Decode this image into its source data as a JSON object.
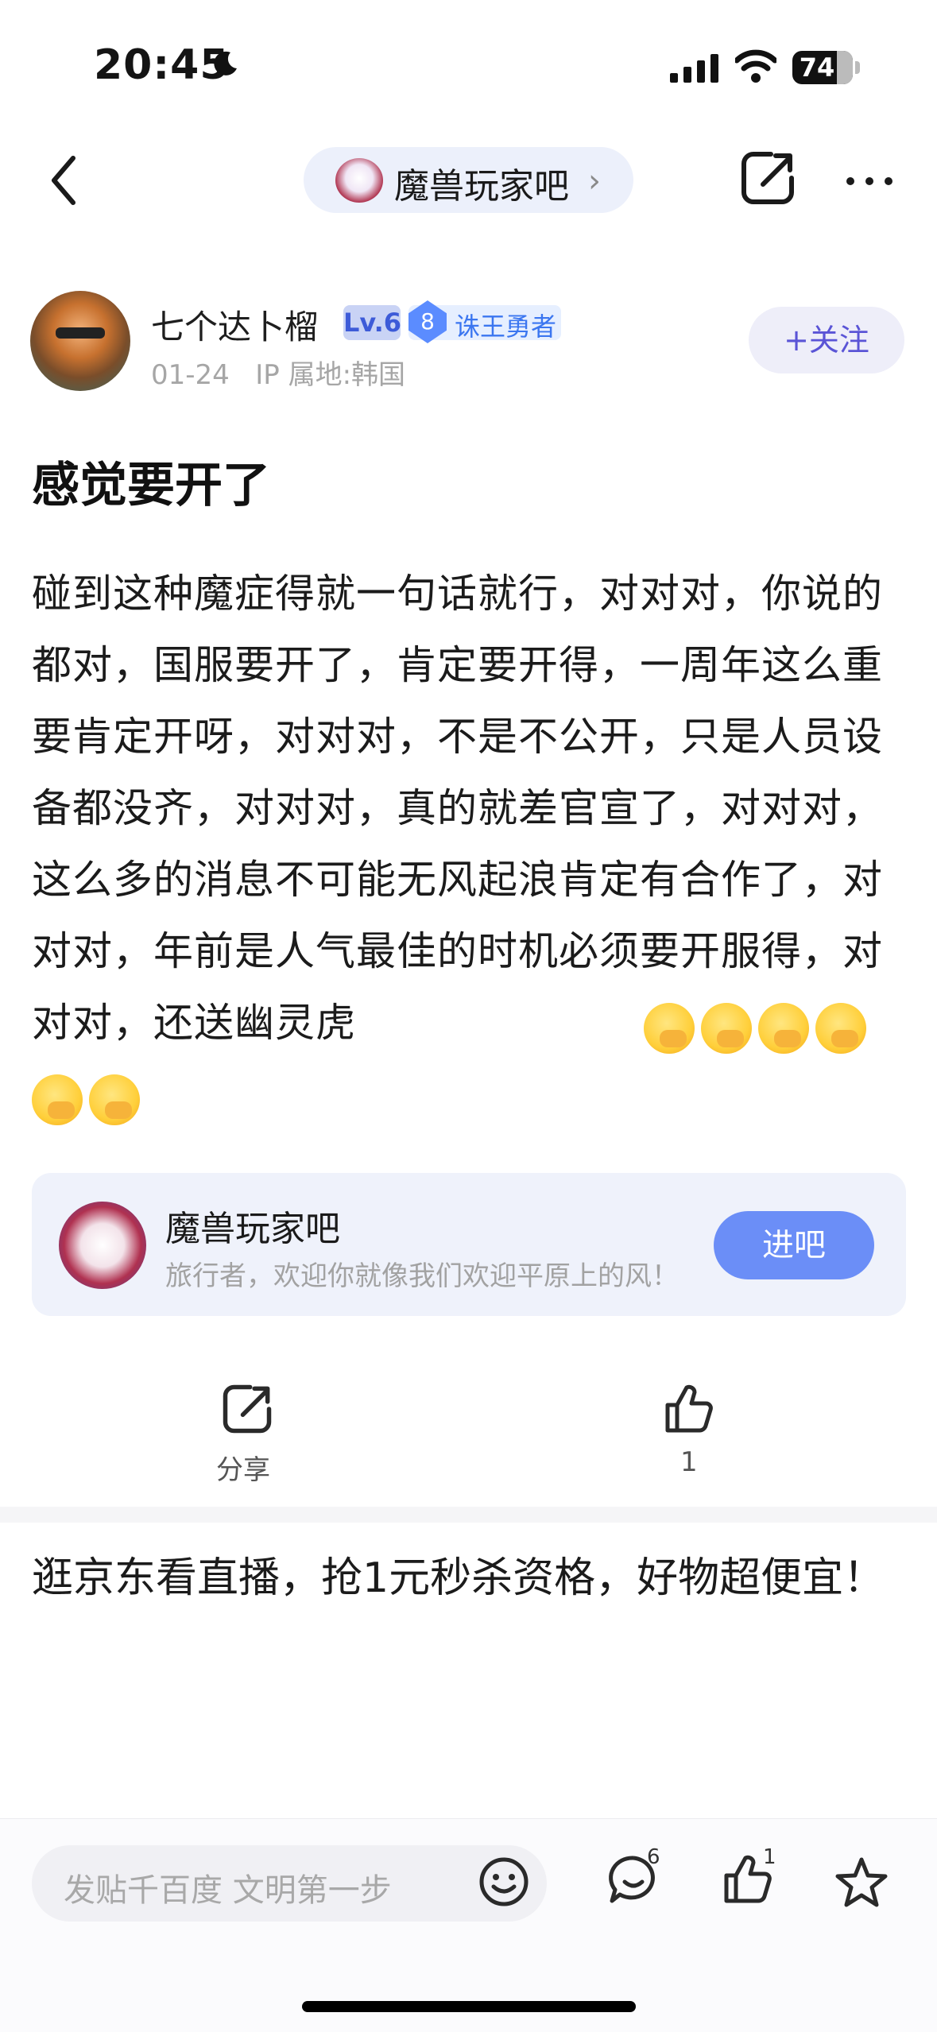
{
  "status_bar": {
    "time": "20:45",
    "battery": "74"
  },
  "nav": {
    "forum_name": "魔兽玩家吧"
  },
  "author": {
    "name": "七个达卜榴",
    "level": "Lv.6",
    "honor_level": "8",
    "honor_title": "诛王勇者",
    "date": "01-24",
    "ip": "IP 属地:韩国",
    "follow_label": "+关注"
  },
  "post": {
    "title": "感觉要开了",
    "body": "碰到这种魔症得就一句话就行，对对对，你说的都对，国服要开了，肯定要开得，一周年这么重要肯定开呀，对对对，不是不公开，只是人员设备都没齐，对对对，真的就差官宣了，对对对，这么多的消息不可能无风起浪肯定有合作了，对对对，年前是人气最佳的时机必须要开服得，对对对，还送幽灵虎"
  },
  "forum_card": {
    "name": "魔兽玩家吧",
    "slogan": "旅行者，欢迎你就像我们欢迎平原上的风！",
    "enter_label": "进吧"
  },
  "actions": {
    "share_label": "分享",
    "like_count": "1"
  },
  "ad": {
    "text": "逛京东看直播，抢1元秒杀资格，好物超便宜！"
  },
  "bottom_bar": {
    "placeholder": "发贴千百度 文明第一步",
    "comment_count": "6",
    "like_count": "1"
  },
  "icons": {
    "back": "chevron-left-icon",
    "share": "share-icon",
    "more": "more-icon",
    "like": "thumbs-up-icon",
    "emoji": "smile-icon",
    "comment": "comment-icon",
    "favorite": "star-icon"
  }
}
